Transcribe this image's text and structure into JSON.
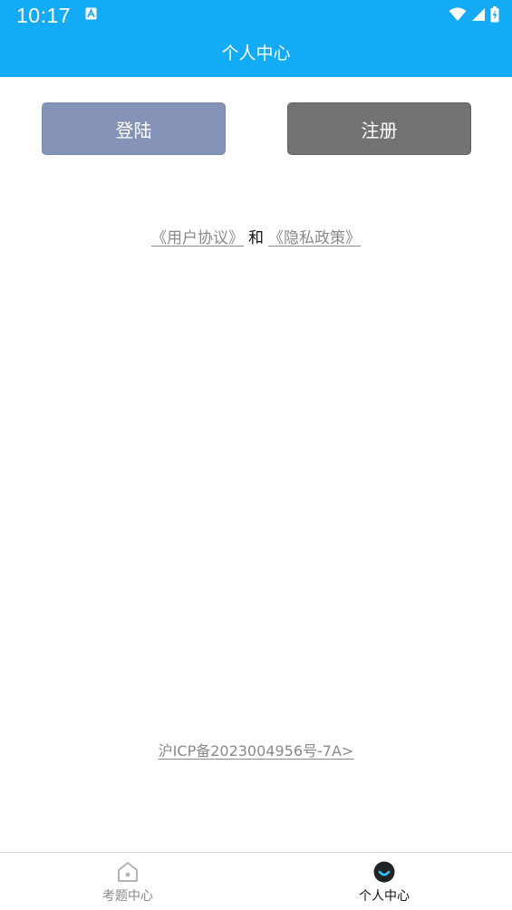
{
  "status_bar": {
    "time": "10:17",
    "icons": [
      "a-notification-icon",
      "wifi-icon",
      "signal-icon",
      "battery-charging-icon"
    ]
  },
  "header": {
    "title": "个人中心",
    "background_color": "#13aaf6"
  },
  "actions": {
    "login_label": "登陆",
    "login_color": "#8593b9",
    "register_label": "注册",
    "register_color": "#737373"
  },
  "agreement": {
    "user_agreement": "《用户协议》",
    "and_text": "和",
    "privacy_policy": "《隐私政策》"
  },
  "footer": {
    "icp": "沪ICP备2023004956号-7A>"
  },
  "bottom_nav": {
    "items": [
      {
        "label": "考题中心",
        "icon": "home-icon",
        "active": false
      },
      {
        "label": "个人中心",
        "icon": "profile-icon",
        "active": true
      }
    ]
  }
}
